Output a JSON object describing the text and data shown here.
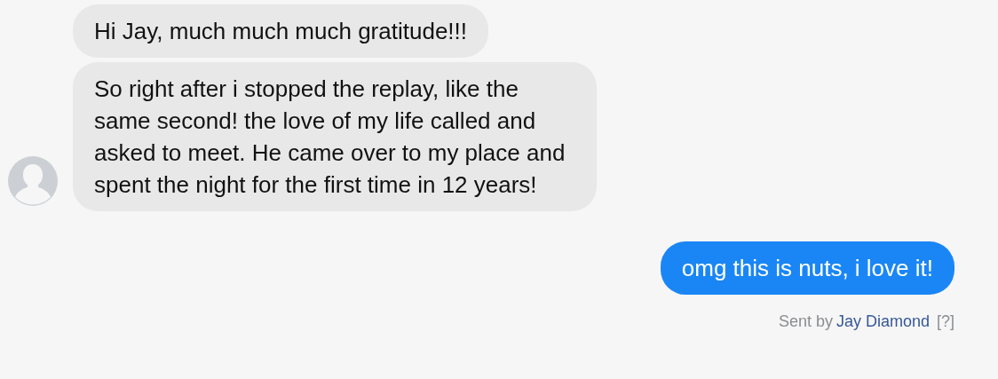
{
  "messages": [
    {
      "kind": "received",
      "text": "Hi Jay, much much much gratitude!!!"
    },
    {
      "kind": "received",
      "text": "So right after i stopped the replay, like the same second! the love of my life called and asked to meet. He came over to my place and spent the night for the first time in 12 years!"
    },
    {
      "kind": "sent",
      "text": "omg this is nuts, i love it!"
    }
  ],
  "footer": {
    "prefix": "Sent by",
    "sender": "Jay Diamond",
    "help": "[?]"
  }
}
